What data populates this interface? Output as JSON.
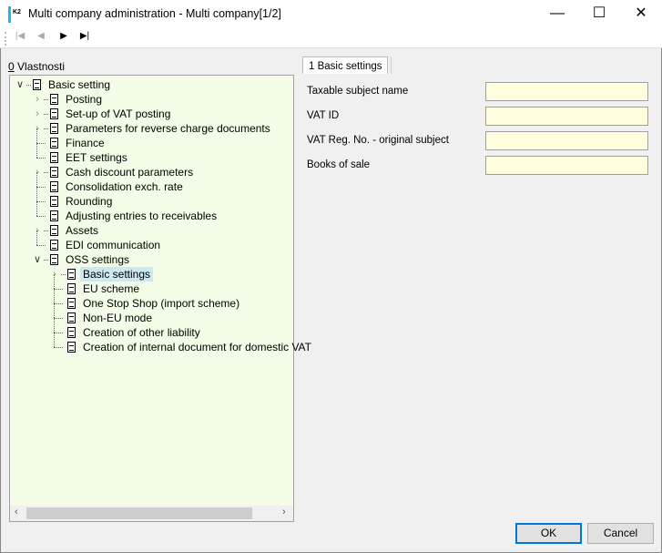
{
  "window": {
    "title": "Multi company administration - Multi company[1/2]",
    "app_icon": "K2"
  },
  "toolbar": {
    "first": "first-record-icon",
    "prev": "previous-record-icon",
    "next": "next-record-icon",
    "last": "last-record-icon"
  },
  "left_panel": {
    "hotkey": "0",
    "label": " Vlastnosti"
  },
  "tree": [
    {
      "label": "Basic setting",
      "level": 0,
      "expander": "open"
    },
    {
      "label": "Posting",
      "level": 1,
      "expander": "closed"
    },
    {
      "label": "Set-up of VAT posting",
      "level": 1,
      "expander": "closed"
    },
    {
      "label": "Parameters for reverse charge documents",
      "level": 1,
      "expander": "closed"
    },
    {
      "label": "Finance",
      "level": 1,
      "expander": "none"
    },
    {
      "label": "EET settings",
      "level": 1,
      "expander": "none"
    },
    {
      "label": "Cash discount parameters",
      "level": 1,
      "expander": "closed"
    },
    {
      "label": "Consolidation exch. rate",
      "level": 1,
      "expander": "none"
    },
    {
      "label": "Rounding",
      "level": 1,
      "expander": "none"
    },
    {
      "label": "Adjusting entries to receivables",
      "level": 1,
      "expander": "none"
    },
    {
      "label": "Assets",
      "level": 1,
      "expander": "closed"
    },
    {
      "label": "EDI communication",
      "level": 1,
      "expander": "none"
    },
    {
      "label": "OSS settings",
      "level": 1,
      "expander": "open"
    },
    {
      "label": "Basic settings",
      "level": 2,
      "expander": "closed",
      "selected": true
    },
    {
      "label": "EU scheme",
      "level": 2,
      "expander": "none"
    },
    {
      "label": "One Stop Shop (import scheme)",
      "level": 2,
      "expander": "none"
    },
    {
      "label": "Non-EU mode",
      "level": 2,
      "expander": "none"
    },
    {
      "label": "Creation of other liability",
      "level": 2,
      "expander": "none"
    },
    {
      "label": "Creation of internal document for domestic VAT",
      "level": 2,
      "expander": "none"
    }
  ],
  "tab": {
    "label": "1 Basic settings"
  },
  "fields": [
    {
      "label": "Taxable subject name",
      "value": ""
    },
    {
      "label": "VAT ID",
      "value": ""
    },
    {
      "label": "VAT Reg. No. - original subject",
      "value": ""
    },
    {
      "label": "Books of sale",
      "value": ""
    }
  ],
  "buttons": {
    "ok": "OK",
    "cancel": "Cancel"
  }
}
